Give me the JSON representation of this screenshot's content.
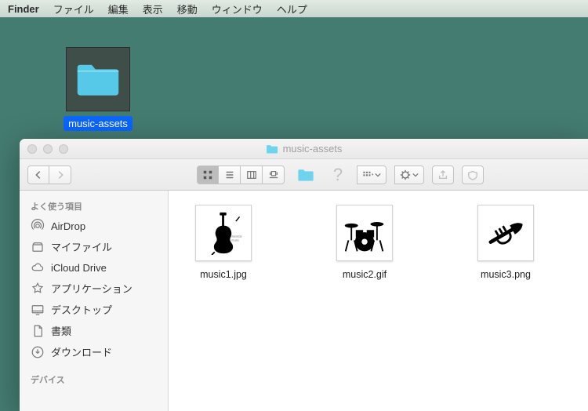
{
  "menubar": {
    "app": "Finder",
    "items": [
      "ファイル",
      "編集",
      "表示",
      "移動",
      "ウィンドウ",
      "ヘルプ"
    ]
  },
  "desktop": {
    "folder_label": "music-assets"
  },
  "window": {
    "title": "music-assets"
  },
  "sidebar": {
    "h_favorites": "よく使う項目",
    "h_devices": "デバイス",
    "items": [
      {
        "label": "AirDrop"
      },
      {
        "label": "マイファイル"
      },
      {
        "label": "iCloud Drive"
      },
      {
        "label": "アプリケーション"
      },
      {
        "label": "デスクトップ"
      },
      {
        "label": "書類"
      },
      {
        "label": "ダウンロード"
      }
    ]
  },
  "files": [
    {
      "name": "music1.jpg",
      "kind": "cello"
    },
    {
      "name": "music2.gif",
      "kind": "drums"
    },
    {
      "name": "music3.png",
      "kind": "trumpet"
    }
  ]
}
